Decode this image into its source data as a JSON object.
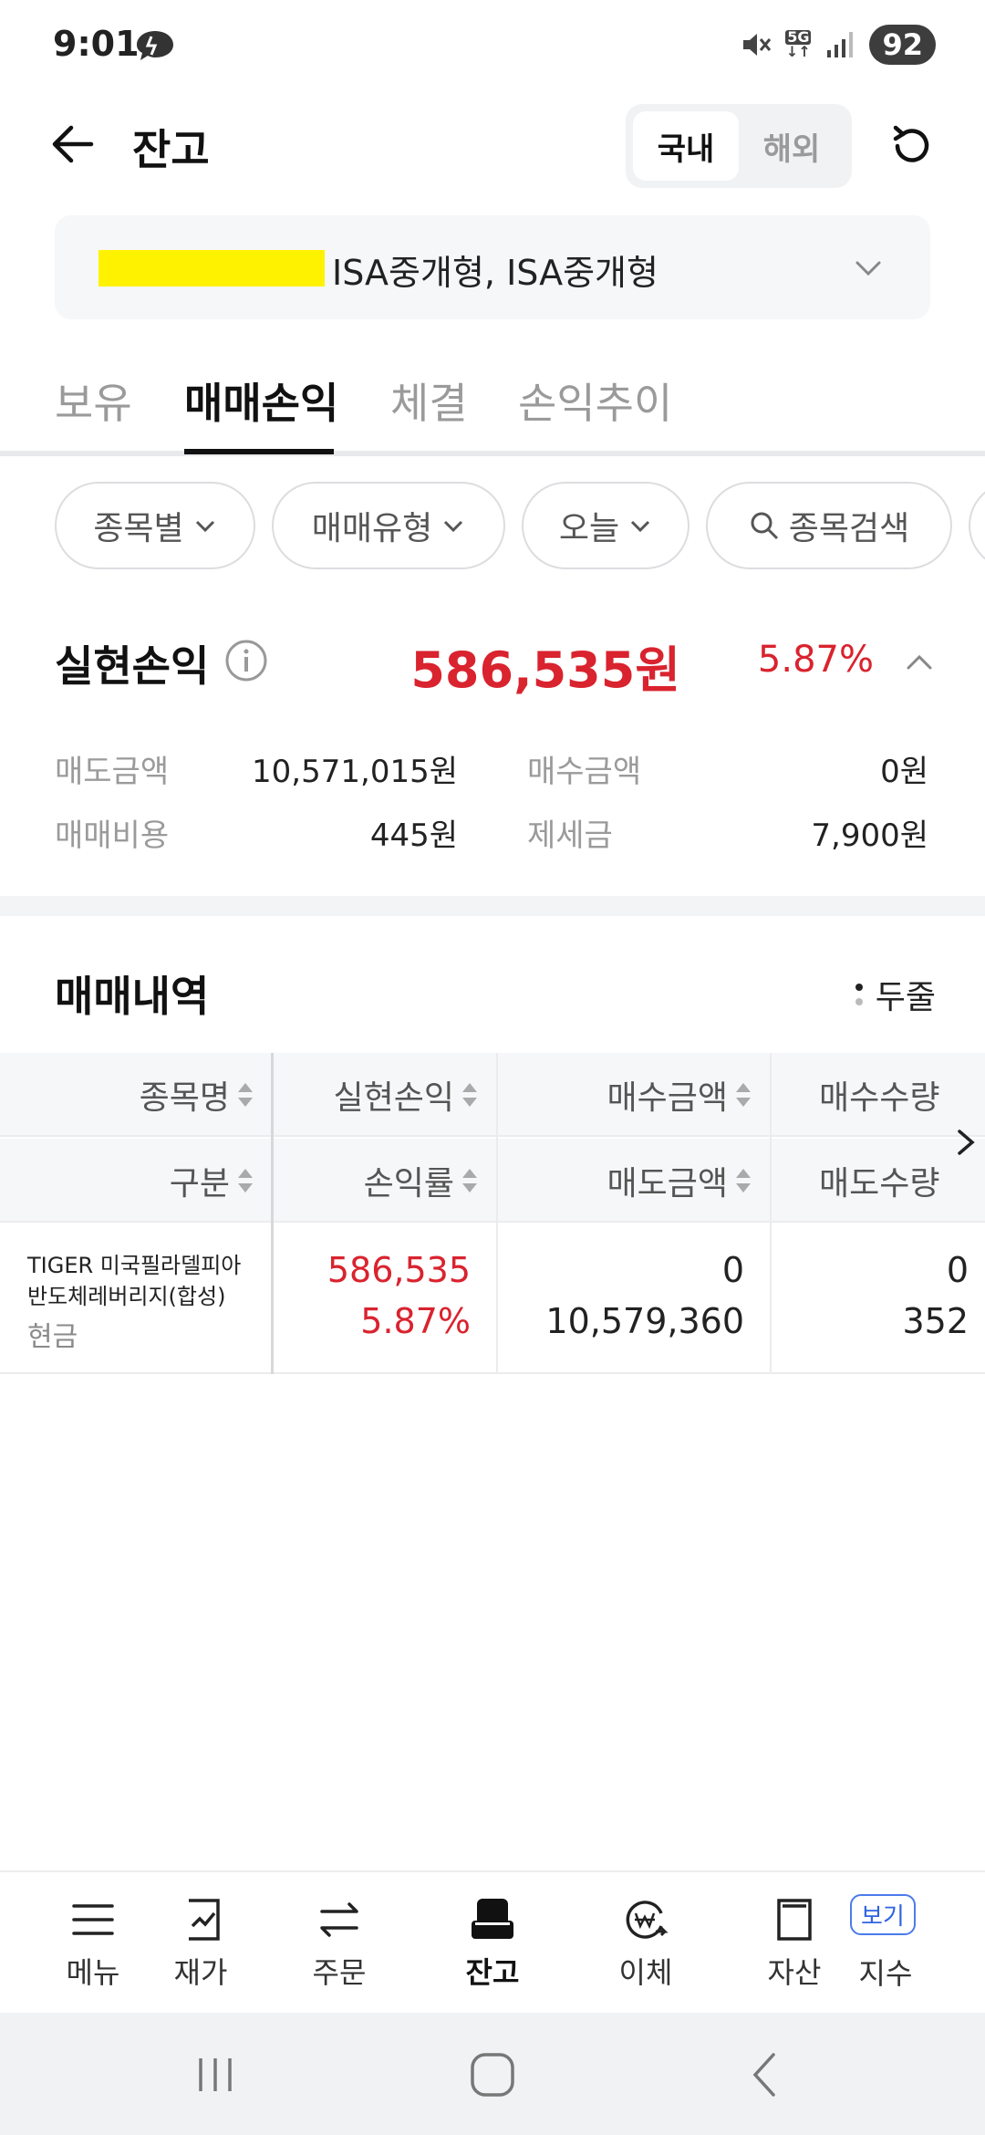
{
  "status": {
    "time": "9:01",
    "network": "5G",
    "battery": "92"
  },
  "header": {
    "title": "잔고",
    "segments": [
      "국내",
      "해외"
    ],
    "active_segment": "국내"
  },
  "account": {
    "name": "ISA중개형, ISA중개형",
    "mask_color": "#fff200"
  },
  "tabs": [
    "보유",
    "매매손익",
    "체결",
    "손익추이"
  ],
  "active_tab": "매매손익",
  "filters": {
    "by_stock": "종목별",
    "trade_type": "매매유형",
    "period": "오늘",
    "search": "종목검색"
  },
  "realized": {
    "title": "실현손익",
    "amount": "586,535원",
    "rate": "5.87%",
    "accent_color": "#d9232e",
    "sell_amount_label": "매도금액",
    "sell_amount": "10,571,015원",
    "buy_amount_label": "매수금액",
    "buy_amount": "0원",
    "fee_label": "매매비용",
    "fee": "445원",
    "tax_label": "제세금",
    "tax": "7,900원"
  },
  "history": {
    "title": "매매내역",
    "two_line_label": "두줄",
    "header_row1": [
      "종목명",
      "실현손익",
      "매수금액",
      "매수수량"
    ],
    "header_row2": [
      "구분",
      "손익률",
      "매도금액",
      "매도수량"
    ],
    "rows": [
      {
        "name_line1": "TIGER 미국필라델피아",
        "name_line2": "반도체레버리지(합성)",
        "type": "현금",
        "realized": "586,535",
        "rate": "5.87%",
        "buy_amount": "0",
        "sell_amount": "10,579,360",
        "buy_qty": "0",
        "sell_qty": "352"
      }
    ]
  },
  "bottom_nav": {
    "menu": "메뉴",
    "price": "재가",
    "order": "주문",
    "balance": "잔고",
    "transfer": "이체",
    "asset": "자산",
    "index": "지수",
    "view_badge": "보기"
  }
}
